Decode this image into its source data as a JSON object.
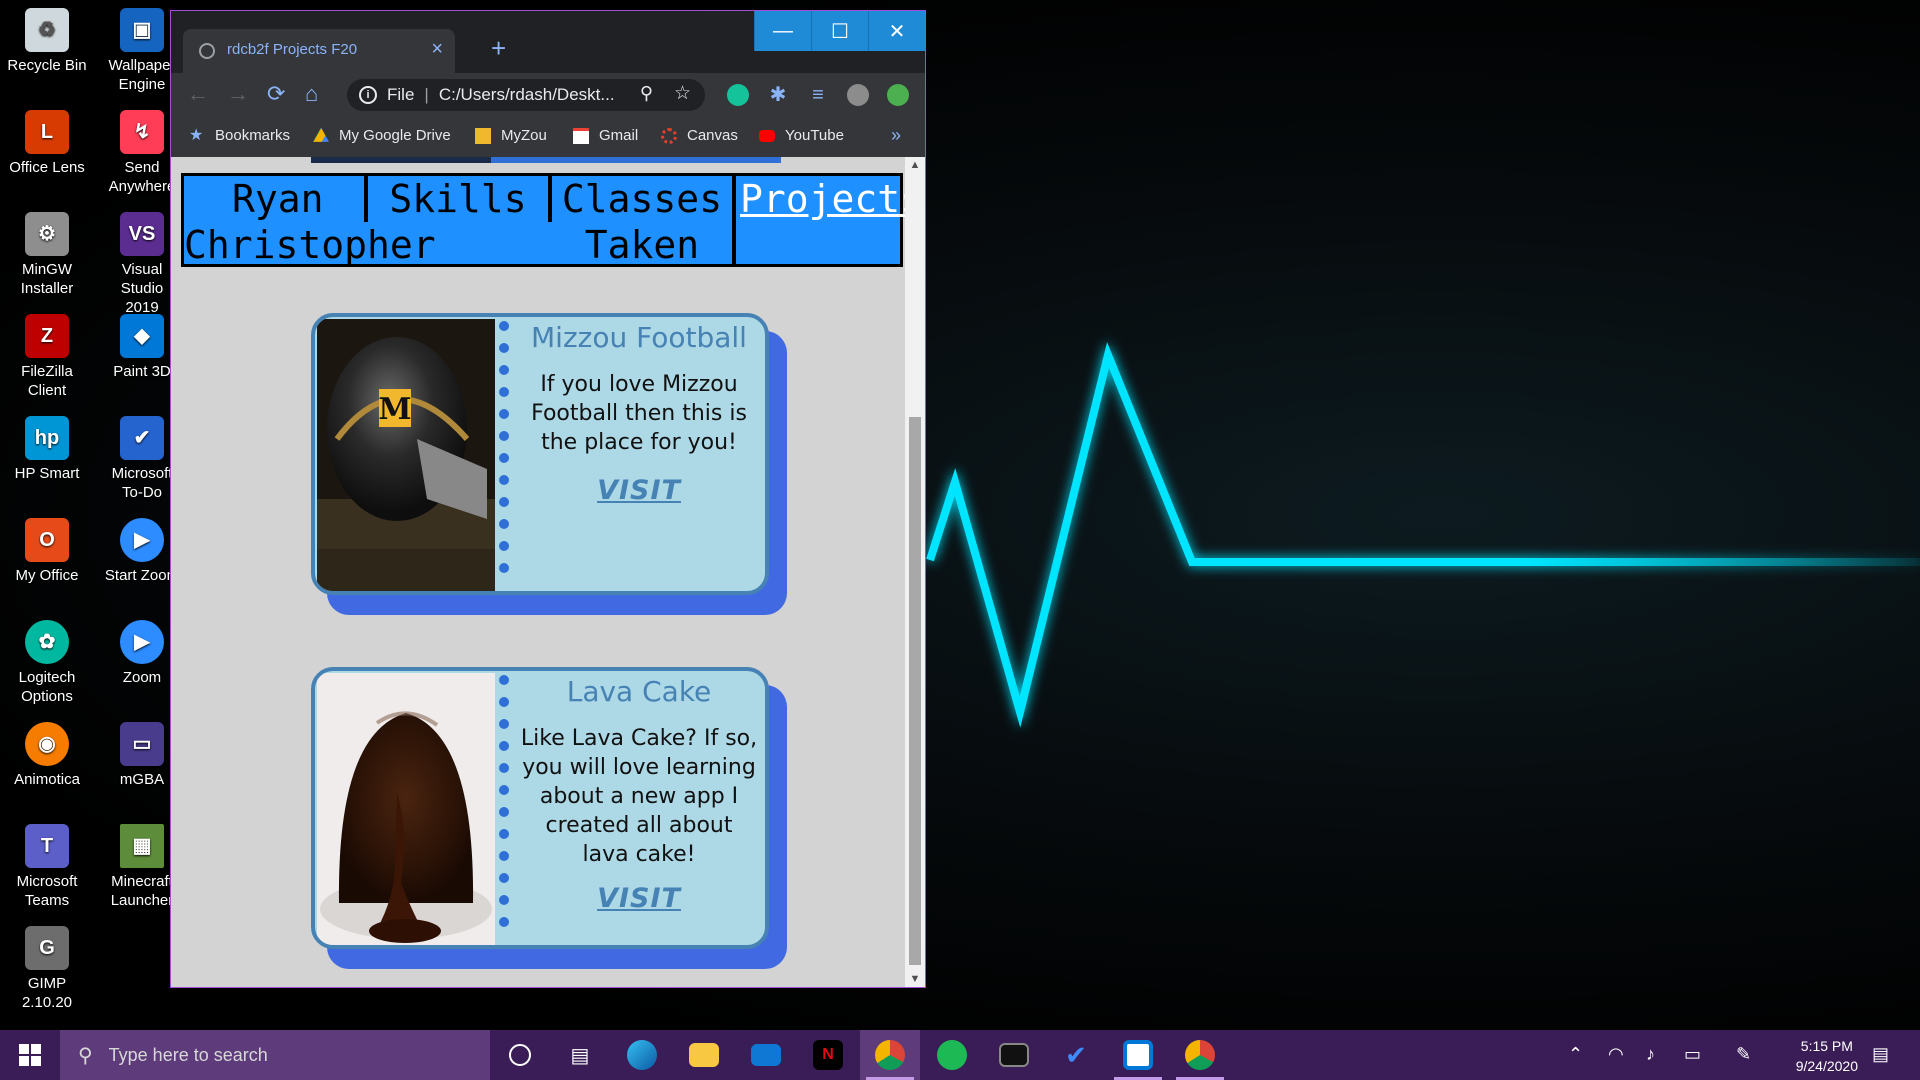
{
  "desktop": {
    "icons": [
      {
        "label": "Recycle Bin",
        "icon": "recycle-bin-icon"
      },
      {
        "label": "Wallpaper Engine",
        "icon": "wallpaper-engine-icon"
      },
      {
        "label": "Office Lens",
        "icon": "office-lens-icon"
      },
      {
        "label": "Send Anywhere",
        "icon": "send-anywhere-icon"
      },
      {
        "label": "MinGW Installer",
        "icon": "mingw-icon"
      },
      {
        "label": "Visual Studio 2019",
        "icon": "visual-studio-icon"
      },
      {
        "label": "FileZilla Client",
        "icon": "filezilla-icon"
      },
      {
        "label": "Paint 3D",
        "icon": "paint-3d-icon"
      },
      {
        "label": "HP Smart",
        "icon": "hp-smart-icon"
      },
      {
        "label": "Microsoft To-Do",
        "icon": "todo-icon"
      },
      {
        "label": "My Office",
        "icon": "office-icon"
      },
      {
        "label": "Start Zoom",
        "icon": "zoom-icon"
      },
      {
        "label": "Logitech Options",
        "icon": "logitech-icon"
      },
      {
        "label": "Zoom",
        "icon": "zoom-icon"
      },
      {
        "label": "Animotica",
        "icon": "animotica-icon"
      },
      {
        "label": "mGBA",
        "icon": "mgba-icon"
      },
      {
        "label": "Microsoft Teams",
        "icon": "teams-icon"
      },
      {
        "label": "Minecraft Launcher",
        "icon": "minecraft-icon"
      },
      {
        "label": "GIMP 2.10.20",
        "icon": "gimp-icon"
      }
    ]
  },
  "browser": {
    "tab_title": "rdcb2f Projects F20",
    "new_tab": "+",
    "close_tab": "×",
    "controls": {
      "minimize": "—",
      "maximize": "☐",
      "close": "✕"
    },
    "nav": {
      "back": "←",
      "forward": "→",
      "reload": "⟳",
      "home": "⌂"
    },
    "address": {
      "scheme": "File",
      "url": "C:/Users/rdash/Deskt..."
    },
    "bookmarks": [
      {
        "label": "Bookmarks",
        "icon": "star-icon",
        "color": "#8ab4f8"
      },
      {
        "label": "My Google Drive",
        "icon": "google-drive-icon",
        "color": "#f4b400"
      },
      {
        "label": "MyZou",
        "icon": "myzou-icon",
        "color": "#f1b82d"
      },
      {
        "label": "Gmail",
        "icon": "gmail-icon",
        "color": "#ea4335"
      },
      {
        "label": "Canvas",
        "icon": "canvas-icon",
        "color": "#e13f2b"
      },
      {
        "label": "YouTube",
        "icon": "youtube-icon",
        "color": "#ff0000"
      }
    ],
    "more_bookmarks": "»"
  },
  "page": {
    "nav": {
      "name_line1": "Ryan",
      "name_line2": "Christopher",
      "skills": "Skills",
      "classes_line1": "Classes",
      "classes_line2": "Taken",
      "projects": "Projects"
    },
    "cards": [
      {
        "title": "Mizzou Football",
        "text": "If you love Mizzou Football then this is the place for you!",
        "link": "VISIT"
      },
      {
        "title": "Lava Cake",
        "text": "Like Lava Cake? If so, you will love learning about a new app I created all about lava cake!",
        "link": "VISIT"
      }
    ]
  },
  "taskbar": {
    "search_placeholder": "Type here to search",
    "time": "5:15 PM",
    "date": "9/24/2020"
  },
  "colors": {
    "nav_bg": "#1e90ff",
    "card_bg": "#add8e6",
    "card_border": "#4682b4",
    "card_shadow": "#4169e1",
    "page_bg": "#d3d3d3",
    "taskbar": "#3a1d56",
    "heartbeat": "#00e5ff"
  }
}
